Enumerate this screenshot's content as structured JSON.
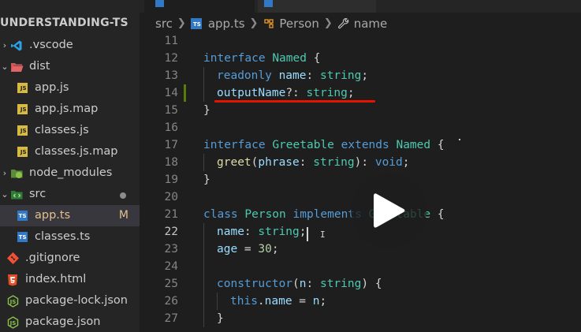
{
  "explorer": {
    "project_name": "UNDERSTANDING-TS",
    "items": [
      {
        "label": ".vscode",
        "kind": "folder"
      },
      {
        "label": "dist",
        "kind": "folder"
      },
      {
        "label": "app.js",
        "kind": "js"
      },
      {
        "label": "app.js.map",
        "kind": "js"
      },
      {
        "label": "classes.js",
        "kind": "js"
      },
      {
        "label": "classes.js.map",
        "kind": "js"
      },
      {
        "label": "node_modules",
        "kind": "folder"
      },
      {
        "label": "src",
        "kind": "folder"
      },
      {
        "label": "app.ts",
        "kind": "ts",
        "badge": "M"
      },
      {
        "label": "classes.ts",
        "kind": "ts"
      },
      {
        "label": ".gitignore",
        "kind": "git"
      },
      {
        "label": "index.html",
        "kind": "html"
      },
      {
        "label": "package-lock.json",
        "kind": "node"
      },
      {
        "label": "package.json",
        "kind": "node"
      }
    ]
  },
  "icon_colors": {
    "vscode": "#29a2e8",
    "dist_folder": "#e26565",
    "js": "#d7ba42",
    "ts": "#3178c6",
    "node_modules": "#8bc34a",
    "src_folder": "#4caf50",
    "git": "#f05033",
    "html": "#e44d26",
    "node": "#8bc34a"
  },
  "breadcrumb": {
    "root": "src",
    "file": "app.ts",
    "symbol": "Person",
    "member": "name"
  },
  "editor": {
    "lines": [
      {
        "n": "11"
      },
      {
        "n": "12"
      },
      {
        "n": "13"
      },
      {
        "n": "14"
      },
      {
        "n": "15"
      },
      {
        "n": "16"
      },
      {
        "n": "17"
      },
      {
        "n": "18"
      },
      {
        "n": "19"
      },
      {
        "n": "20"
      },
      {
        "n": "21"
      },
      {
        "n": "22"
      },
      {
        "n": "23"
      },
      {
        "n": "24"
      },
      {
        "n": "25"
      },
      {
        "n": "26"
      },
      {
        "n": "27"
      }
    ],
    "tokens": {
      "interface": "interface",
      "Named": "Named",
      "open_brace": " {",
      "readonly": "readonly",
      "name": "name",
      "colon": ": ",
      "string": "string",
      "semi": ";",
      "outputName": "outputName",
      "optional_colon": "?: ",
      "close_brace": "}",
      "Greetable": "Greetable",
      "extends": "extends",
      "greet": "greet",
      "paren_open": "(",
      "phrase": "phrase",
      "paren_close_colon": "): ",
      "void": "void",
      "class": "class",
      "Person": "Person",
      "implements": "implements",
      "age": "age",
      "equals": " = ",
      "thirty": "30",
      "constructor": "constructor",
      "n": "n",
      "paren_close_brace": ") {",
      "this": "this",
      "dot": ".",
      "space": " "
    }
  },
  "video": {
    "play_icon": "play-icon"
  }
}
